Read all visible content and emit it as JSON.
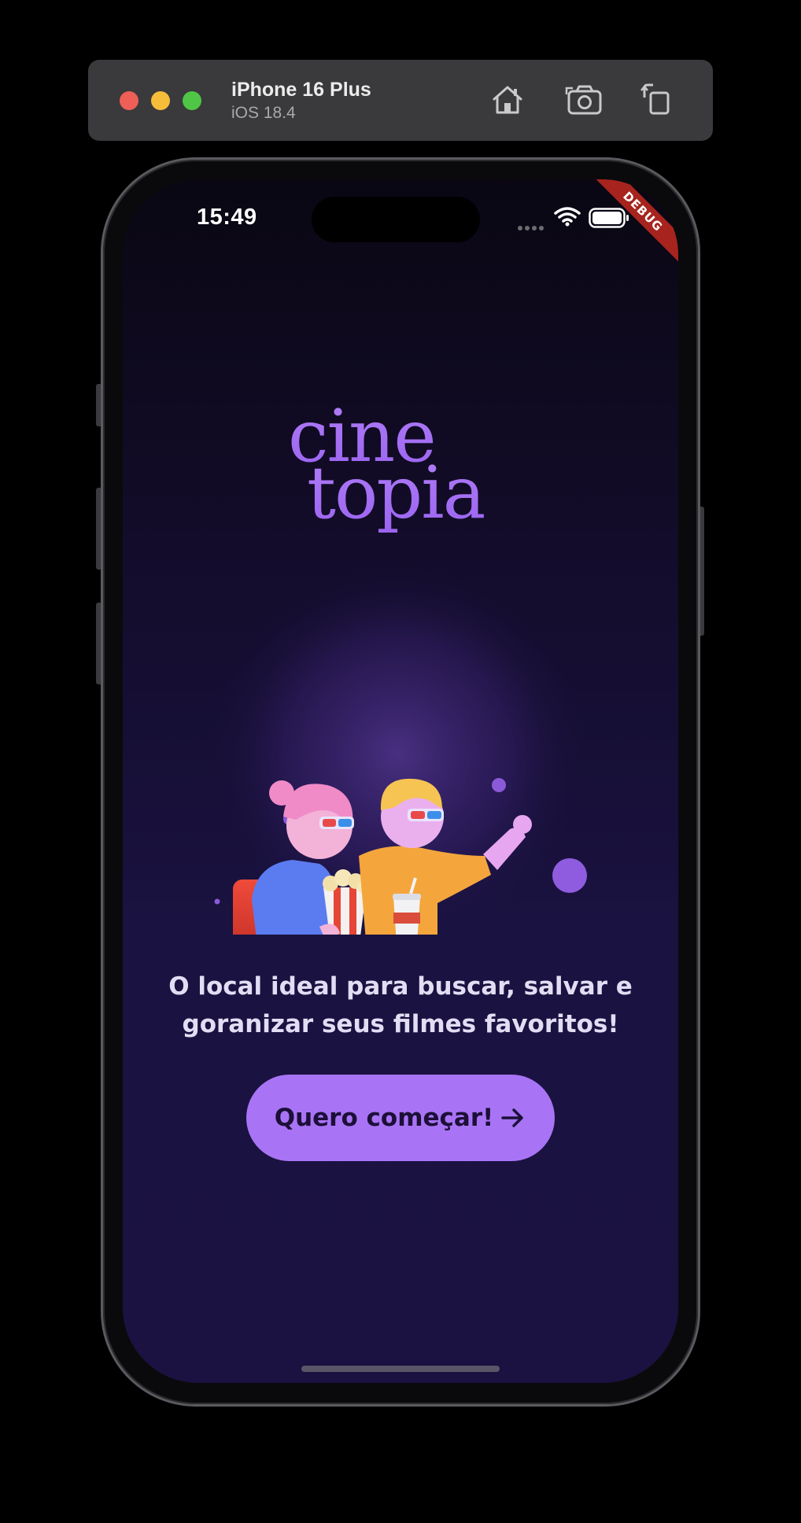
{
  "simulator": {
    "device_name": "iPhone 16 Plus",
    "os_version": "iOS 18.4",
    "toolbar_icons": [
      "home-icon",
      "screenshot-icon",
      "rotate-icon"
    ]
  },
  "status_bar": {
    "time": "15:49",
    "icons": [
      "cellular-icon",
      "wifi-icon",
      "battery-icon"
    ]
  },
  "debug_banner": "DEBUG",
  "logo": {
    "line1": "cine",
    "line2": "topia",
    "color": "#a874f5"
  },
  "hero_illustration": "two-people-watching-movie-with-3d-glasses",
  "tagline": "O local ideal para buscar, salvar e goranizar seus filmes favoritos!",
  "cta": {
    "label": "Quero começar!",
    "icon": "arrow-right-icon",
    "color": "#a874f5"
  },
  "colors": {
    "background_top": "#0a0713",
    "background_bottom": "#1b1241",
    "accent": "#a874f5"
  }
}
